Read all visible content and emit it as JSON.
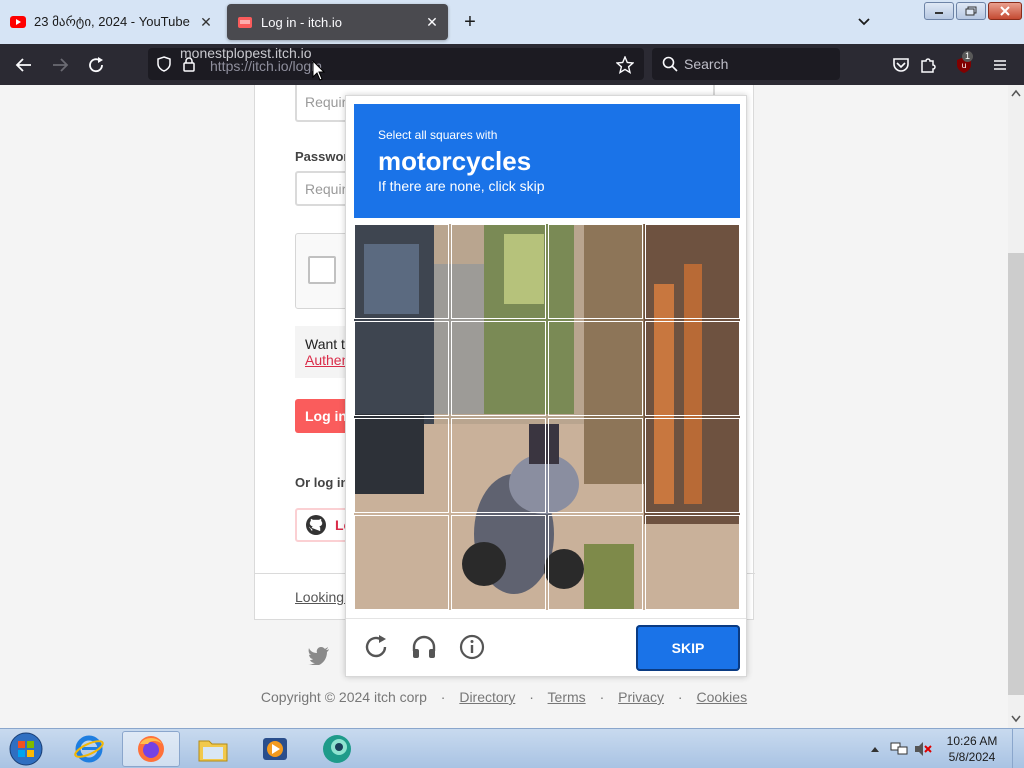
{
  "browser": {
    "tabs": [
      {
        "title": "23 მარტი, 2024 - YouTube",
        "active": false
      },
      {
        "title": "Log in - itch.io",
        "active": true
      }
    ],
    "url_overlay": "monestplopest.itch.io",
    "url": "https://itch.io/login",
    "search_placeholder": "Search",
    "extension_badge": "1"
  },
  "page": {
    "username_placeholder": "Required",
    "password_label": "Password",
    "password_placeholder": "Required",
    "auth_text": "Want t",
    "auth_link": "Authen",
    "login_button": "Log in",
    "or_login": "Or log in",
    "github_button": "Lo",
    "looking_for": "Looking f",
    "footer": {
      "copyright": "Copyright © 2024 itch corp",
      "links": [
        "Directory",
        "Terms",
        "Privacy",
        "Cookies"
      ]
    }
  },
  "captcha": {
    "instruction": "Select all squares with",
    "target": "motorcycles",
    "hint": "If there are none, click skip",
    "skip_button": "SKIP",
    "accent_color": "#1a73e8"
  },
  "taskbar": {
    "time": "10:26 AM",
    "date": "5/8/2024"
  }
}
